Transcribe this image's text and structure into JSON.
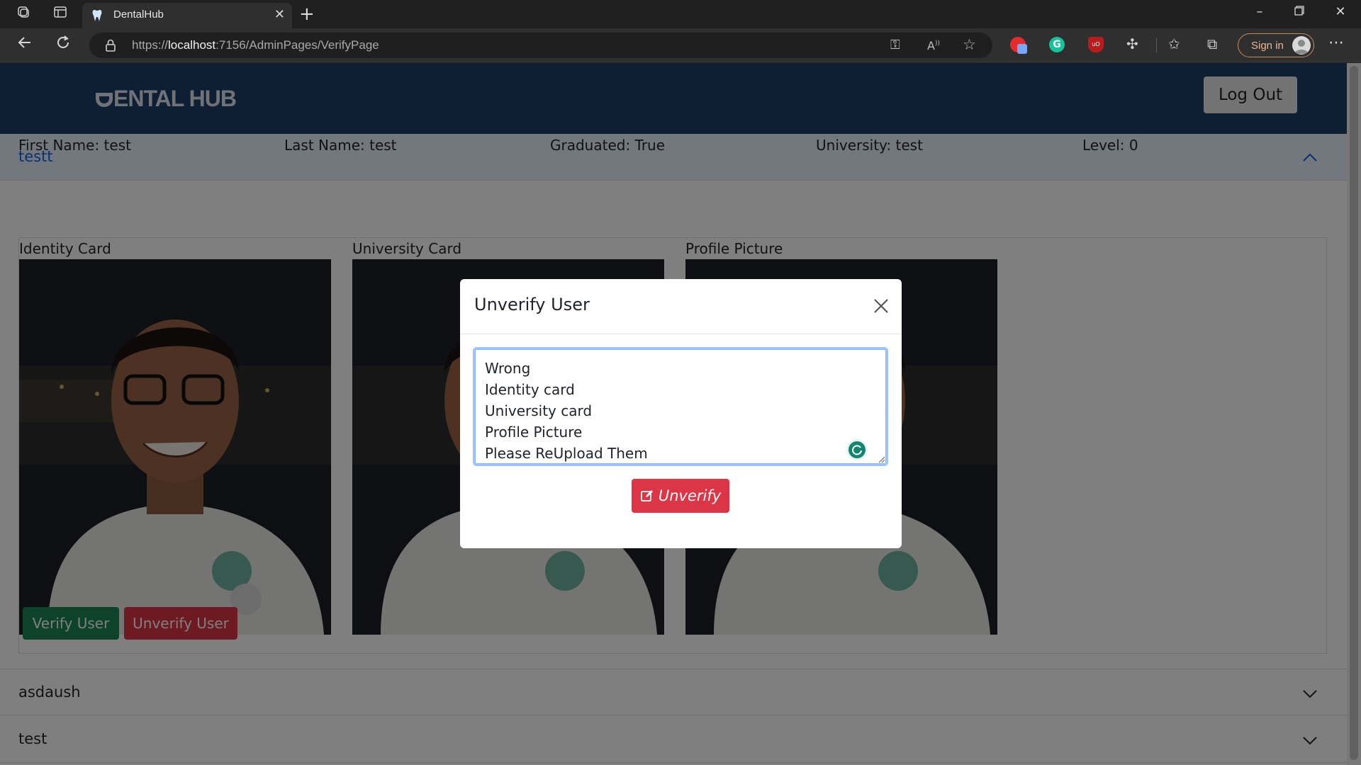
{
  "browser": {
    "tab_title": "DentalHub",
    "url_prefix": "https://",
    "url_host": "localhost",
    "url_rest": ":7156/AdminPages/VerifyPage",
    "signin_label": "Sign in"
  },
  "header": {
    "logo_text": "ENTAL HUB",
    "logout_label": "Log Out"
  },
  "users": [
    {
      "name": "testt",
      "expanded": true,
      "first_name": "First Name: test",
      "last_name": "Last Name: test",
      "graduated": "Graduated: True",
      "university": "University: test",
      "level": "Level: 0",
      "cards": [
        "Identity Card",
        "University Card",
        "Profile Picture"
      ],
      "verify_label": "Verify User",
      "unverify_label": "Unverify User"
    },
    {
      "name": "asdaush",
      "expanded": false
    },
    {
      "name": "test",
      "expanded": false
    }
  ],
  "modal": {
    "title": "Unverify User",
    "reason_lines": [
      "Wrong",
      "Identity card",
      "University card",
      "Profile Picture",
      "Please ReUpload Them"
    ],
    "submit_label": "Unverify"
  },
  "colors": {
    "header_bg": "#1e3f66",
    "accordion_active_text": "#0c63e4",
    "success": "#198754",
    "danger": "#dc3545"
  }
}
